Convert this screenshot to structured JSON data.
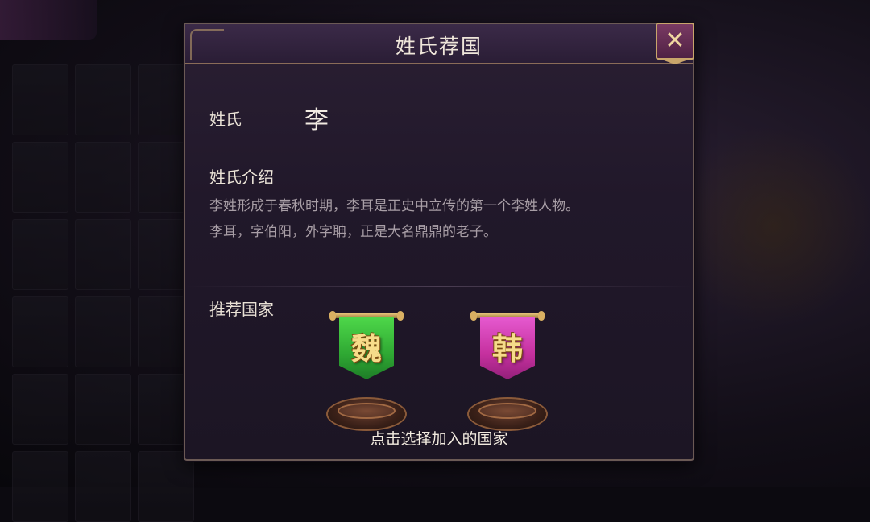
{
  "dialog": {
    "title": "姓氏荐国",
    "close_icon": "close-icon"
  },
  "surname": {
    "label": "姓氏",
    "value": "李"
  },
  "intro": {
    "label": "姓氏介绍",
    "line1": "李姓形成于春秋时期，李耳是正史中立传的第一个李姓人物。",
    "line2": "李耳，字伯阳，外字聃，正是大名鼎鼎的老子。"
  },
  "recommend": {
    "label": "推荐国家",
    "nations": [
      {
        "char": "魏",
        "color": "#2fa833"
      },
      {
        "char": "韩",
        "color": "#c5309e"
      }
    ]
  },
  "hint": "点击选择加入的国家"
}
